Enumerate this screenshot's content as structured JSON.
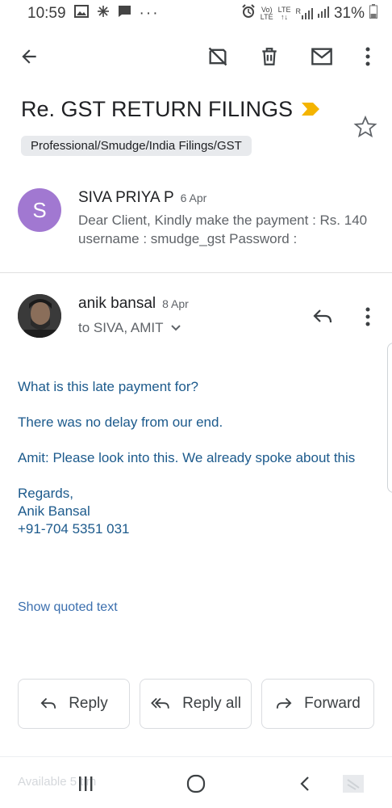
{
  "status_bar": {
    "time": "10:59",
    "battery": "31%",
    "volte_top": "Vo)",
    "volte_bottom": "LTE",
    "lte_top": "LTE",
    "lte_bottom": "↑↓",
    "roaming": "R"
  },
  "subject": "Re. GST RETURN FILINGS",
  "label": "Professional/Smudge/India Filings/GST",
  "messages": {
    "collapsed": {
      "avatar_letter": "S",
      "avatar_color": "#a178d1",
      "sender": "SIVA PRIYA P",
      "date": "6 Apr",
      "snippet": "Dear Client, Kindly make the payment : Rs. 140 username : smudge_gst Password :"
    },
    "expanded": {
      "sender": "anik bansal",
      "date": "8 Apr",
      "recipients": "to SIVA, AMIT",
      "body": [
        "What is this late payment for?",
        "There was no delay from our end.",
        "Amit: Please look into this. We already spoke about this"
      ],
      "signature": [
        "Regards,",
        "Anik Bansal",
        "+91-704 5351 031"
      ],
      "show_quoted": "Show quoted text"
    }
  },
  "actions": {
    "reply": "Reply",
    "reply_all": "Reply all",
    "forward": "Forward"
  },
  "navbar": {
    "ghost_text": "Available 5 tim"
  },
  "colors": {
    "link_blue": "#1c5a8c",
    "important_yellow": "#f4b400"
  }
}
